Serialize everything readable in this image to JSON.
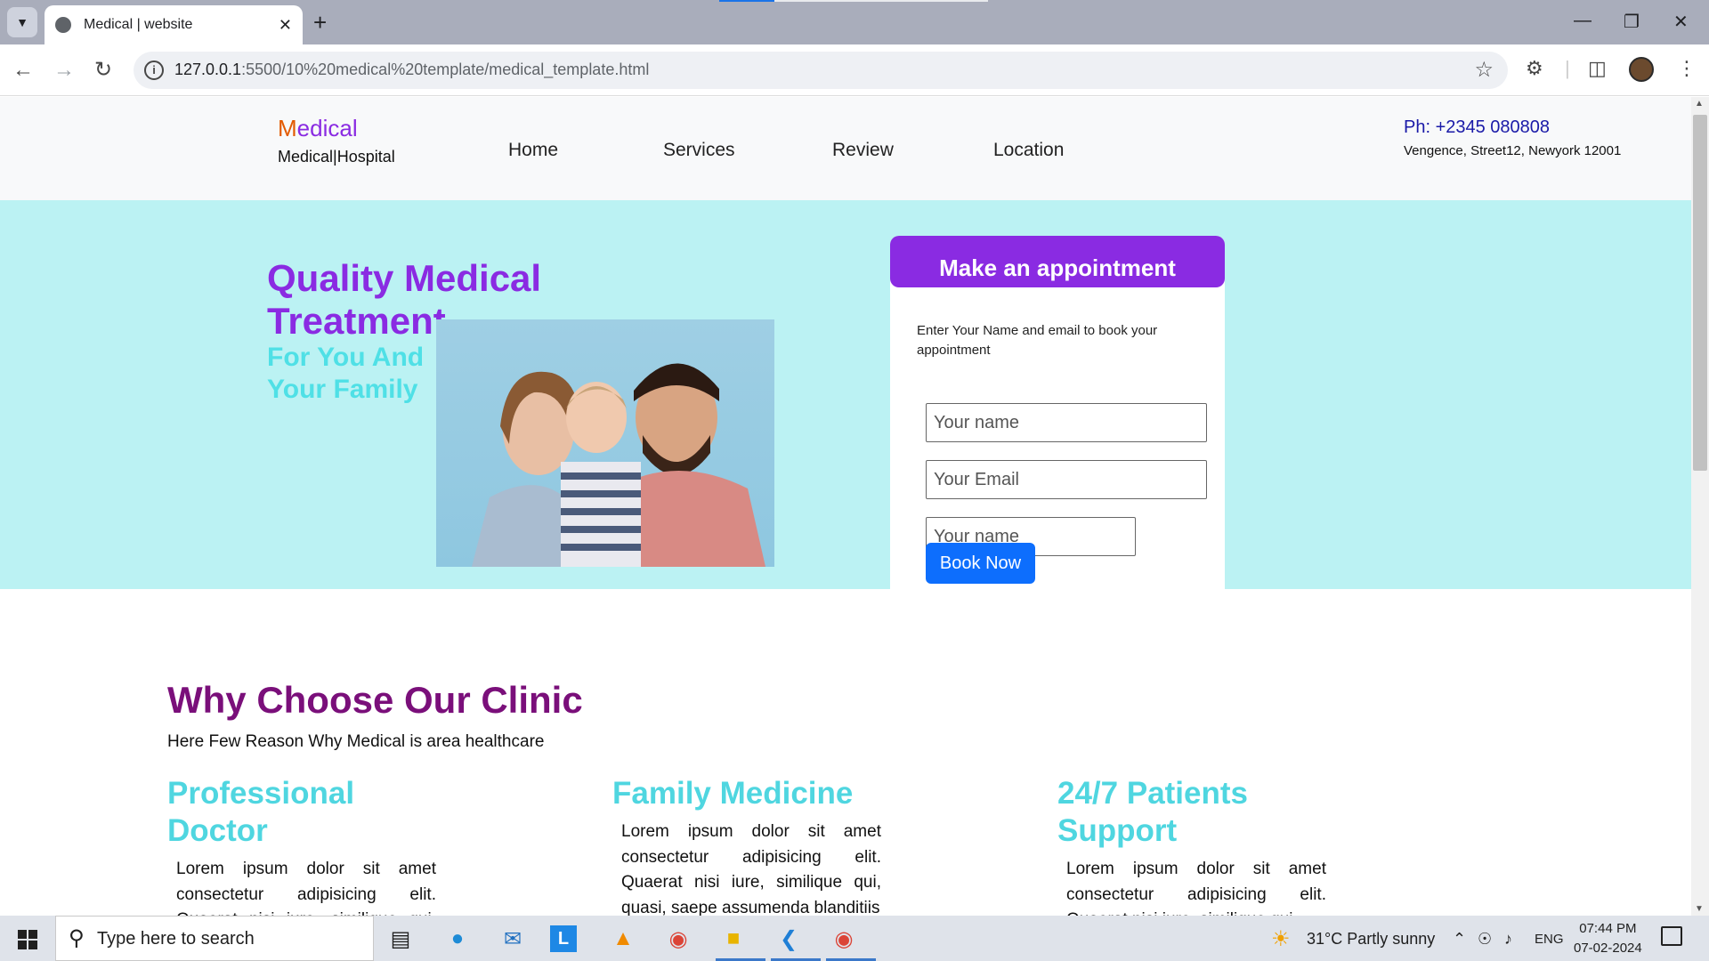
{
  "browser": {
    "tab_title": "Medical | website",
    "url_host": "127.0.0.1",
    "url_rest": ":5500/10%20medical%20template/medical_template.html"
  },
  "site": {
    "brand_first": "M",
    "brand_rest": "edical",
    "brand_sub": "Medical|Hospital",
    "nav": [
      "Home",
      "Services",
      "Review",
      "Location"
    ],
    "phone": "Ph: +2345 080808",
    "address": "Vengence, Street12, Newyork 12001"
  },
  "hero": {
    "title": "Quality Medical Treatment",
    "subtitle": "For You And Your Family"
  },
  "appointment": {
    "heading": "Make an appointment",
    "description": "Enter Your Name and email to book your appointment",
    "name_placeholder": "Your name",
    "email_placeholder": "Your Email",
    "name2_placeholder": "Your name",
    "button": "Book Now"
  },
  "why": {
    "title": "Why Choose Our Clinic",
    "subtitle": "Here Few Reason Why Medical is area healthcare",
    "features": [
      {
        "title": "Professional Doctor",
        "body": "Lorem ipsum dolor sit amet consectetur adipisicing elit. Quaerat nisi iure, similique qui, quasi, saepe assumenda blanditiis"
      },
      {
        "title": "Family Medicine",
        "body": "Lorem ipsum dolor sit amet consectetur adipisicing elit. Quaerat nisi iure, similique qui, quasi, saepe assumenda blanditiis"
      },
      {
        "title": "24/7 Patients Support",
        "body": "Lorem ipsum dolor sit amet consectetur adipisicing elit. Quaerat nisi iure, similique qui,"
      }
    ]
  },
  "taskbar": {
    "search_placeholder": "Type here to search",
    "weather": "31°C  Partly sunny",
    "language": "ENG",
    "time": "07:44 PM",
    "date": "07-02-2024"
  }
}
